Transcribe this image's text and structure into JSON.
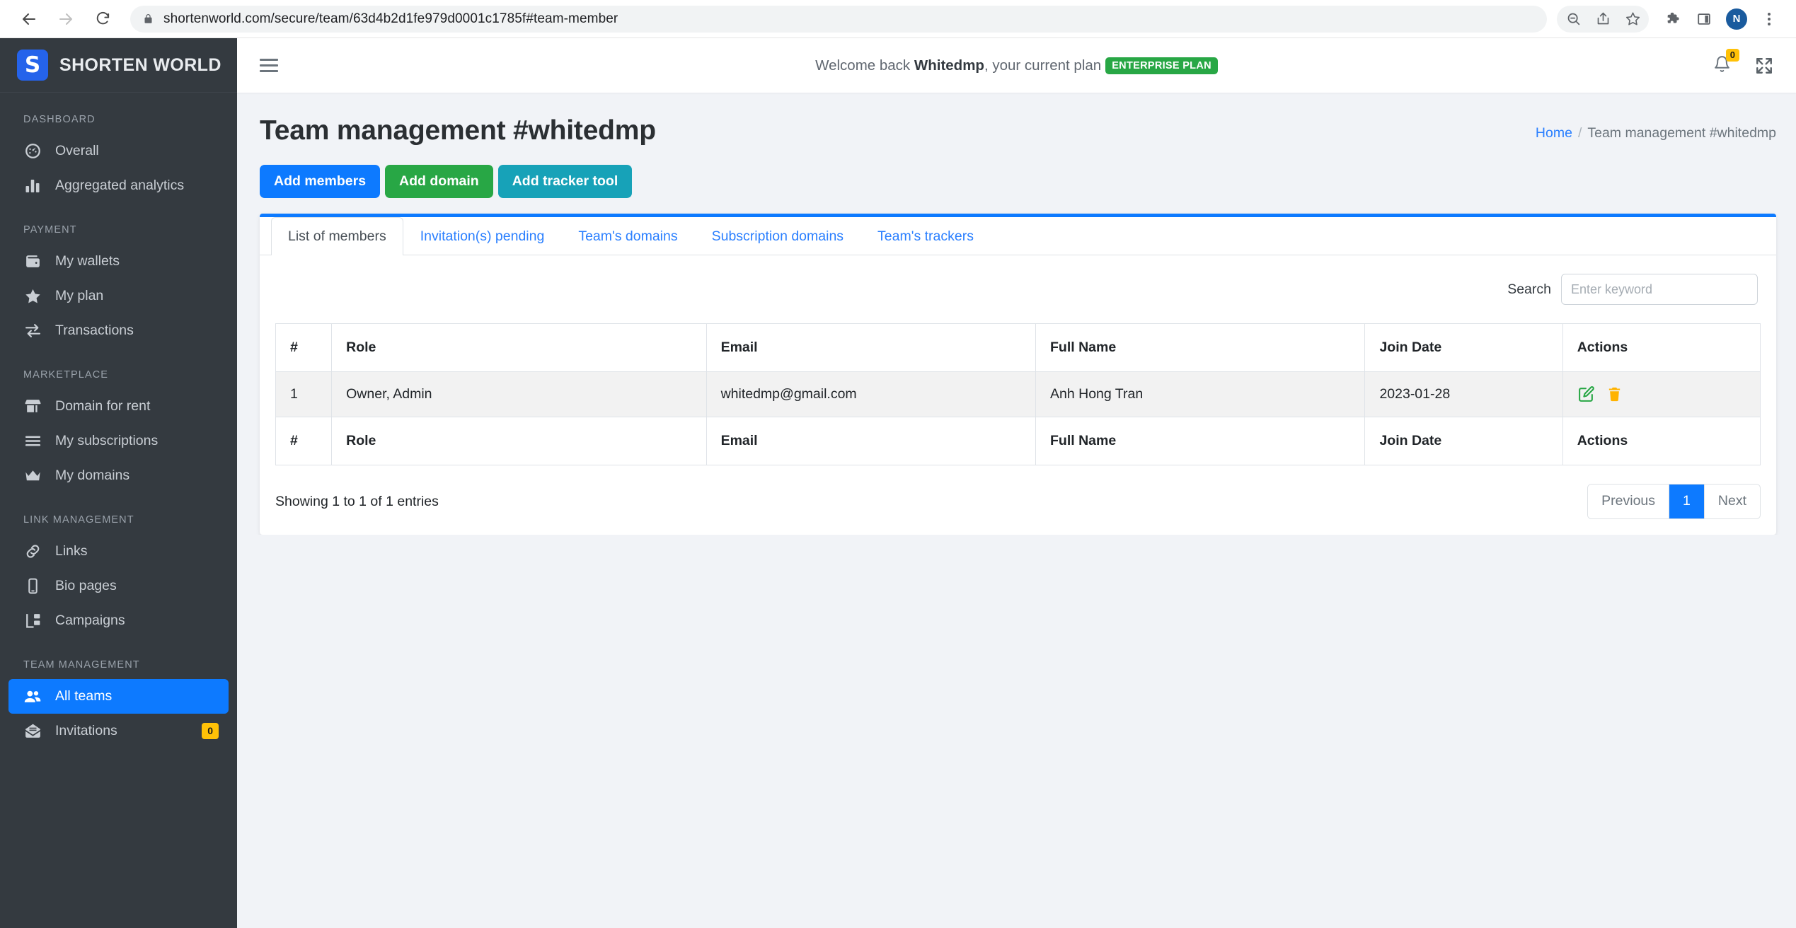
{
  "browser": {
    "url": "shortenworld.com/secure/team/63d4b2d1fe979d0001c1785f#team-member",
    "profile_initial": "N"
  },
  "sidebar": {
    "brand": "SHORTEN WORLD",
    "brand_mark": "S",
    "sections": [
      {
        "title": "DASHBOARD",
        "items": [
          {
            "label": "Overall",
            "icon": "gauge-icon",
            "active": false
          },
          {
            "label": "Aggregated analytics",
            "icon": "bar-chart-icon",
            "active": false
          }
        ]
      },
      {
        "title": "PAYMENT",
        "items": [
          {
            "label": "My wallets",
            "icon": "wallet-icon",
            "active": false
          },
          {
            "label": "My plan",
            "icon": "star-icon",
            "active": false
          },
          {
            "label": "Transactions",
            "icon": "exchange-arrows-icon",
            "active": false
          }
        ]
      },
      {
        "title": "MARKETPLACE",
        "items": [
          {
            "label": "Domain for rent",
            "icon": "store-icon",
            "active": false
          },
          {
            "label": "My subscriptions",
            "icon": "list-icon",
            "active": false
          },
          {
            "label": "My domains",
            "icon": "crown-icon",
            "active": false
          }
        ]
      },
      {
        "title": "LINK MANAGEMENT",
        "items": [
          {
            "label": "Links",
            "icon": "link-chain-icon",
            "active": false
          },
          {
            "label": "Bio pages",
            "icon": "mobile-phone-icon",
            "active": false
          },
          {
            "label": "Campaigns",
            "icon": "sitemap-icon",
            "active": false
          }
        ]
      },
      {
        "title": "TEAM MANAGEMENT",
        "items": [
          {
            "label": "All teams",
            "icon": "users-icon",
            "active": true
          },
          {
            "label": "Invitations",
            "icon": "envelope-open-icon",
            "active": false,
            "badge": "0"
          }
        ]
      }
    ]
  },
  "topbar": {
    "welcome_prefix": "Welcome back ",
    "user_name": "Whitedmp",
    "welcome_suffix": ", your current plan",
    "plan_badge": "ENTERPRISE PLAN",
    "notification_count": "0"
  },
  "page": {
    "title": "Team management #whitedmp",
    "breadcrumb": {
      "home": "Home",
      "separator": "/",
      "current": "Team management #whitedmp"
    },
    "buttons": {
      "add_members": "Add members",
      "add_domain": "Add domain",
      "add_tracker_tool": "Add tracker tool"
    }
  },
  "tabs": [
    {
      "label": "List of members",
      "active": true
    },
    {
      "label": "Invitation(s) pending",
      "active": false
    },
    {
      "label": "Team's domains",
      "active": false
    },
    {
      "label": "Subscription domains",
      "active": false
    },
    {
      "label": "Team's trackers",
      "active": false
    }
  ],
  "search": {
    "label": "Search",
    "placeholder": "Enter keyword",
    "value": ""
  },
  "table": {
    "columns": [
      "#",
      "Role",
      "Email",
      "Full Name",
      "Join Date",
      "Actions"
    ],
    "rows": [
      {
        "index": "1",
        "role": "Owner, Admin",
        "email": "whitedmp@gmail.com",
        "full_name": "Anh Hong Tran",
        "join_date": "2023-01-28"
      }
    ],
    "entries_info": "Showing 1 to 1 of 1 entries"
  },
  "pagination": {
    "previous": "Previous",
    "current_page": "1",
    "next": "Next"
  },
  "colors": {
    "accent_blue": "#0d7aff",
    "success_green": "#28a745",
    "info_teal": "#17a2b8",
    "warning_yellow": "#ffc107",
    "sidebar_bg": "#343a40"
  }
}
